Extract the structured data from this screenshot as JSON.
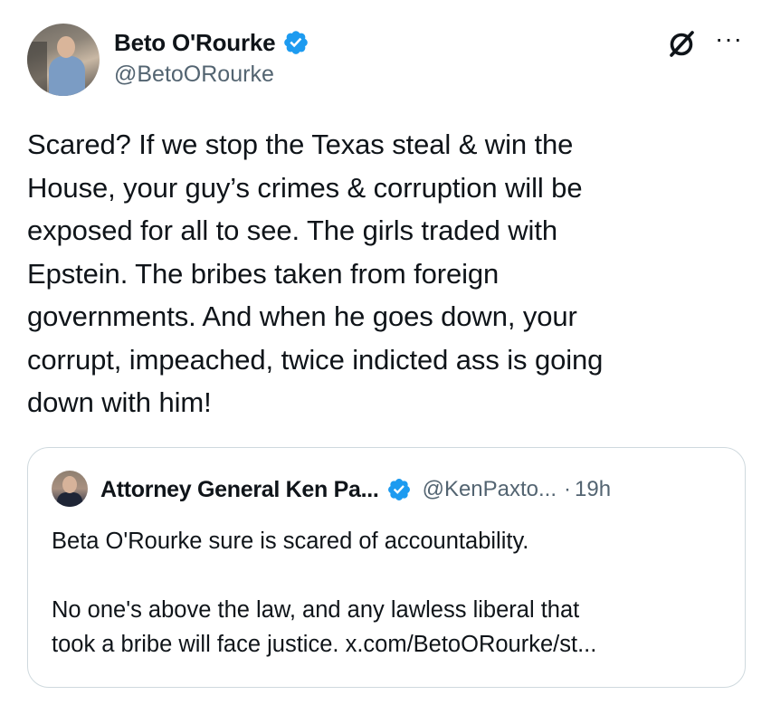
{
  "colors": {
    "verified_badge": "#1d9bf0",
    "secondary_text": "#536471",
    "primary_text": "#0f1419",
    "border": "#cfd9de"
  },
  "tweet": {
    "author": {
      "name": "Beto O'Rourke",
      "handle": "@BetoORourke",
      "avatar": "avatar-photo",
      "verified": true
    },
    "icons": [
      "grok-icon",
      "more-icon"
    ],
    "more_label": "···",
    "text": "Scared? If we stop the Texas steal & win the\nHouse, your guy’s crimes & corruption will be\nexposed for all to see. The girls traded with\nEpstein. The bribes taken from foreign\ngovernments. And when he goes down, your\ncorrupt, impeached, twice indicted ass is going\ndown with him!"
  },
  "quote": {
    "author": {
      "name": "Attorney General Ken Pa...",
      "handle": "@KenPaxto...",
      "verified": true
    },
    "dot": "·",
    "time": "19h",
    "text": "Beta O'Rourke sure is scared of accountability.\n\nNo one's above the law, and any lawless liberal that\ntook a bribe will face justice. x.com/BetoORourke/st..."
  }
}
